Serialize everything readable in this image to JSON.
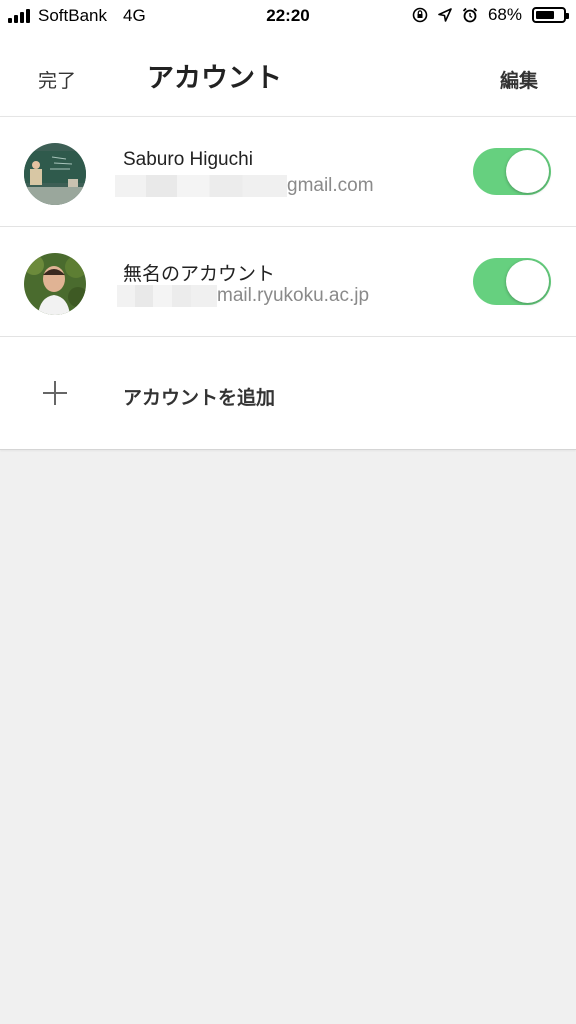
{
  "status_bar": {
    "carrier": "SoftBank",
    "network": "4G",
    "time": "22:20",
    "battery_percent": "68%",
    "battery_level": 0.68,
    "icons": [
      "orientation-lock-icon",
      "location-arrow-icon",
      "alarm-icon"
    ]
  },
  "nav": {
    "left_label": "完了",
    "title": "アカウント",
    "right_label": "編集"
  },
  "accounts": [
    {
      "name": "Saburo Higuchi",
      "email_visible": "gmail.com",
      "enabled": true
    },
    {
      "name": "無名のアカウント",
      "email_visible": "mail.ryukoku.ac.jp",
      "enabled": true
    }
  ],
  "add_account": {
    "label": "アカウントを追加"
  },
  "colors": {
    "toggle_on": "#66d07f",
    "background": "#f0f0f0",
    "card": "#ffffff"
  }
}
